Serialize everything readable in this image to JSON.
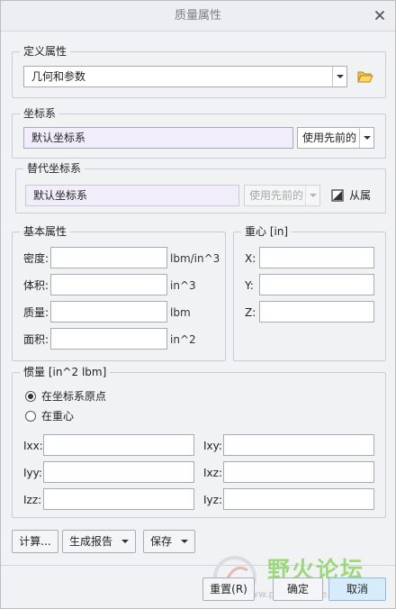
{
  "window": {
    "title": "质量属性"
  },
  "define": {
    "legend": "定义属性",
    "value": "几何和参数"
  },
  "csys": {
    "legend": "坐标系",
    "value": "默认坐标系",
    "mode": "使用先前的"
  },
  "alt_csys": {
    "legend": "替代坐标系",
    "value": "默认坐标系",
    "mode": "使用先前的",
    "from_assembly": "从属"
  },
  "basic": {
    "legend": "基本属性",
    "rows": [
      {
        "label": "密度:",
        "value": "",
        "unit": "lbm/in^3"
      },
      {
        "label": "体积:",
        "value": "",
        "unit": "in^3"
      },
      {
        "label": "质量:",
        "value": "",
        "unit": "lbm"
      },
      {
        "label": "面积:",
        "value": "",
        "unit": "in^2"
      }
    ]
  },
  "cog": {
    "legend": "重心 [in]",
    "rows": [
      {
        "label": "X:",
        "value": ""
      },
      {
        "label": "Y:",
        "value": ""
      },
      {
        "label": "Z:",
        "value": ""
      }
    ]
  },
  "inertia": {
    "legend": "惯量 [in^2 lbm]",
    "options": [
      {
        "label": "在坐标系原点",
        "selected": true
      },
      {
        "label": "在重心",
        "selected": false
      }
    ],
    "left": [
      {
        "label": "Ixx:",
        "value": ""
      },
      {
        "label": "Iyy:",
        "value": ""
      },
      {
        "label": "Izz:",
        "value": ""
      }
    ],
    "right": [
      {
        "label": "Ixy:",
        "value": ""
      },
      {
        "label": "Ixz:",
        "value": ""
      },
      {
        "label": "Iyz:",
        "value": ""
      }
    ]
  },
  "actions": {
    "compute": "计算...",
    "report": "生成报告",
    "save": "保存"
  },
  "footer": {
    "reset": "重置(R)",
    "ok": "确定",
    "cancel": "取消"
  },
  "watermark": {
    "text": "野火论坛",
    "url": "www.proewildfire.cn"
  },
  "colors": {
    "field_lavender": "#f1edfb",
    "primary_button": "#d7ecfa",
    "watermark_green": "#8fd46a"
  }
}
